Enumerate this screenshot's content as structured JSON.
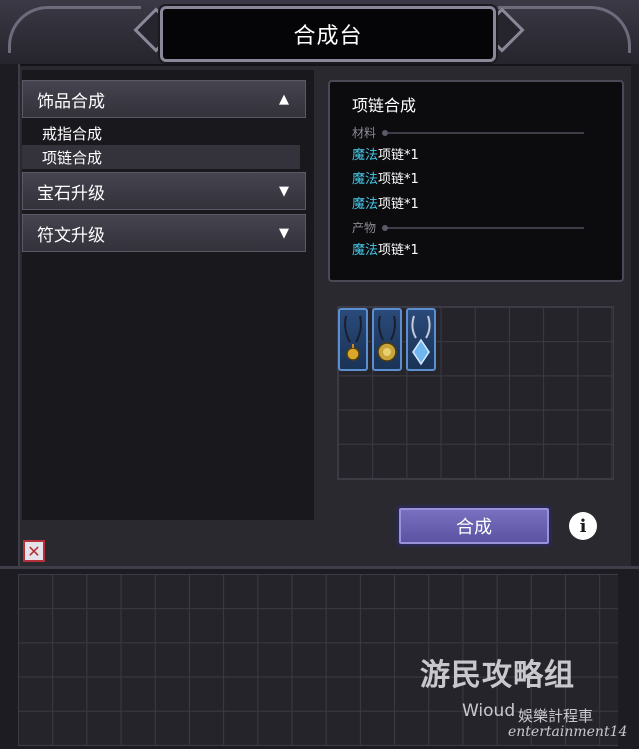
{
  "window": {
    "title": "合成台"
  },
  "categories": [
    {
      "label": "饰品合成",
      "arrow": "▲",
      "expanded": true,
      "subitems": [
        {
          "label": "戒指合成",
          "selected": false
        },
        {
          "label": "项链合成",
          "selected": true
        }
      ]
    },
    {
      "label": "宝石升级",
      "arrow": "▼",
      "expanded": false
    },
    {
      "label": "符文升级",
      "arrow": "▼",
      "expanded": false
    }
  ],
  "recipe": {
    "title": "项链合成",
    "materials_label": "材料",
    "materials": [
      {
        "quality": "魔法",
        "name": "项链*1"
      },
      {
        "quality": "魔法",
        "name": "项链*1"
      },
      {
        "quality": "魔法",
        "name": "项链*1"
      }
    ],
    "product_label": "产物",
    "product": {
      "quality": "魔法",
      "name": "项链*1"
    }
  },
  "slots": [
    {
      "icon": "yellow-gem-necklace-icon"
    },
    {
      "icon": "gold-medallion-necklace-icon"
    },
    {
      "icon": "blue-crystal-necklace-icon"
    }
  ],
  "craft_button": {
    "label": "合成"
  },
  "info_button": {
    "label": "i"
  },
  "close_button": {
    "label": "✕"
  },
  "watermark": {
    "line1": "游民攻略组",
    "line2": "Wioud",
    "line3": "娛樂計程車",
    "line4": "entertainment14"
  },
  "colors": {
    "quality_magic": "#46c9ea",
    "button_purple": "#6a62b0",
    "slot_blue": "#2a4a7a"
  }
}
